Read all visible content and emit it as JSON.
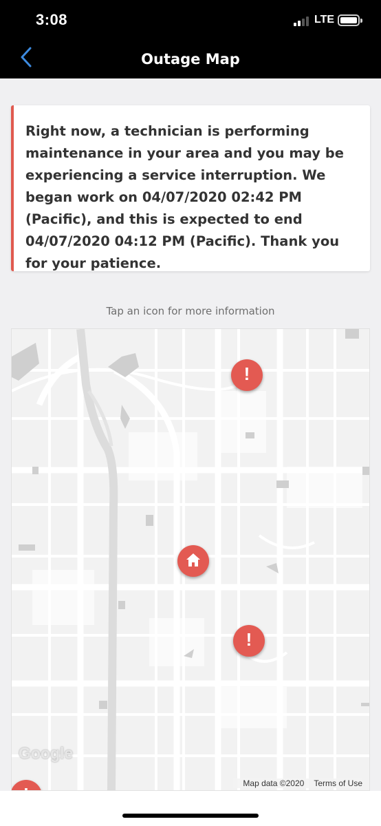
{
  "status_bar": {
    "time": "3:08",
    "network": "LTE",
    "signal_bars": 2,
    "signal_bars_total": 4
  },
  "nav": {
    "title": "Outage Map",
    "back_icon": "chevron-left-icon"
  },
  "alert": {
    "message": "Right now, a technician is performing maintenance in your area and you may be experiencing a service interruption. We began work on 04/07/2020 02:42 PM (Pacific), and this is expected to end 04/07/2020 04:12 PM (Pacific). Thank you for your patience.",
    "accent_color": "#e05a4f"
  },
  "hint": "Tap an icon for more information",
  "map": {
    "markers": [
      {
        "type": "outage",
        "icon": "exclamation-icon",
        "glyph": "!"
      },
      {
        "type": "home",
        "icon": "home-icon"
      },
      {
        "type": "outage",
        "icon": "exclamation-icon",
        "glyph": "!"
      },
      {
        "type": "outage",
        "icon": "exclamation-icon",
        "glyph": "!"
      }
    ],
    "google_logo": "Google",
    "map_data": "Map data ©2020",
    "terms": "Terms of Use",
    "marker_color": "#e35a52"
  }
}
